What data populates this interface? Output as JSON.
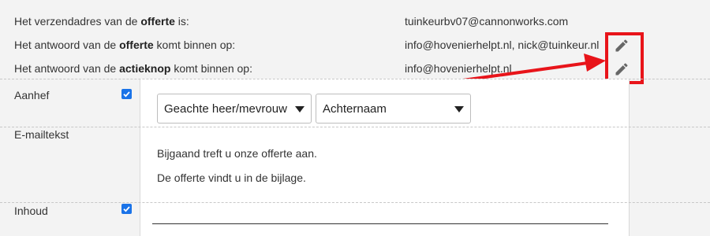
{
  "info": {
    "row1": {
      "prefix": "Het verzendadres van de ",
      "bold": "offerte",
      "suffix": " is:",
      "value": "tuinkeurbv07@cannonworks.com"
    },
    "row2": {
      "prefix": "Het antwoord van de ",
      "bold": "offerte",
      "suffix": " komt binnen op:",
      "value": "info@hovenierhelpt.nl, nick@tuinkeur.nl"
    },
    "row3": {
      "prefix": "Het antwoord van de ",
      "bold": "actieknop",
      "suffix": " komt binnen op:",
      "value": "info@hovenierhelpt.nl"
    }
  },
  "form": {
    "salutation_label": "Aanhef",
    "salutation_select": "Geachte heer/mevrouw",
    "name_select": "Achternaam",
    "email_text_label": "E-mailtekst",
    "email_lines": [
      "Bijgaand treft u onze offerte aan.",
      "De offerte vindt u in de bijlage."
    ],
    "content_label": "Inhoud"
  },
  "colors": {
    "checkbox": "#1a73e8",
    "highlight": "#e8141a"
  },
  "icons": {
    "edit": "pencil-icon",
    "check": "checkmark-icon",
    "dropdown": "caret-down-icon"
  }
}
